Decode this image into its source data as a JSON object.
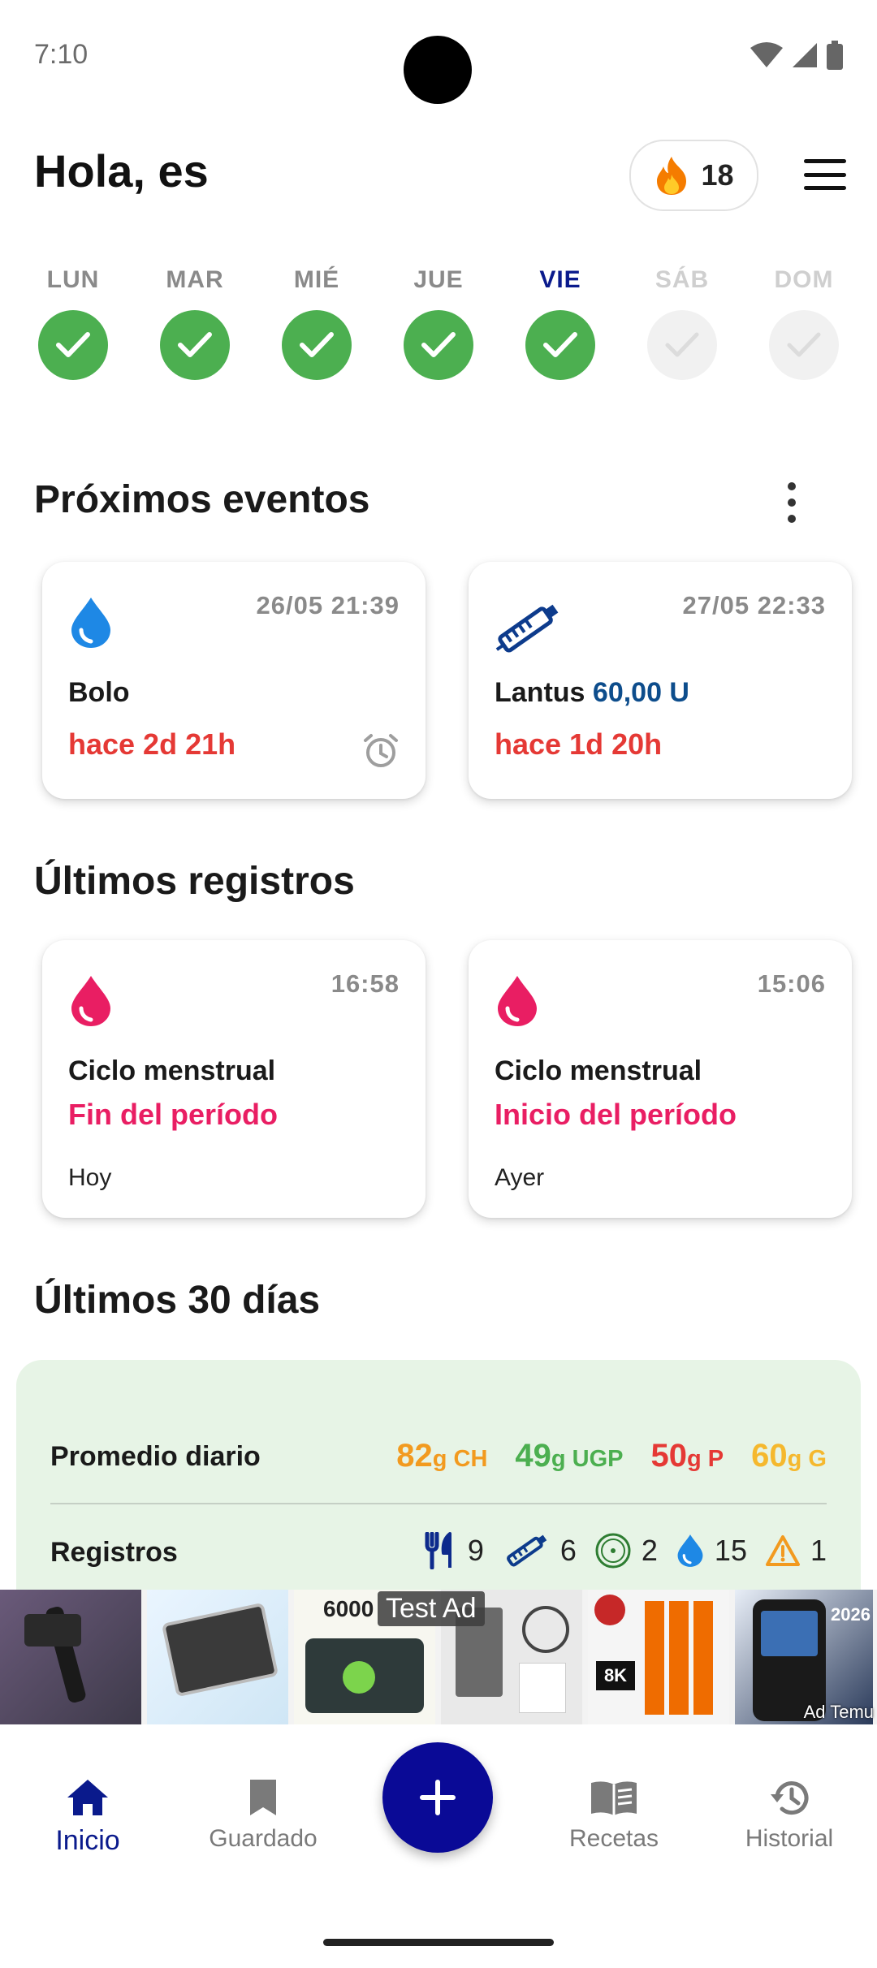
{
  "status": {
    "time": "7:10"
  },
  "header": {
    "greeting": "Hola, es",
    "streak": "18"
  },
  "week": [
    {
      "label": "LUN",
      "done": true
    },
    {
      "label": "MAR",
      "done": true
    },
    {
      "label": "MIÉ",
      "done": true
    },
    {
      "label": "JUE",
      "done": true
    },
    {
      "label": "VIE",
      "done": true,
      "today": true
    },
    {
      "label": "SÁB",
      "done": false
    },
    {
      "label": "DOM",
      "done": false
    }
  ],
  "upcoming": {
    "title": "Próximos eventos",
    "cards": [
      {
        "time": "26/05 21:39",
        "title": "Bolo",
        "extra": "",
        "relative": "hace 2d 21h",
        "icon": "water-drop-icon"
      },
      {
        "time": "27/05 22:33",
        "title": "Lantus",
        "extra": "60,00 U",
        "relative": "hace 1d 20h",
        "icon": "insulin-pen-icon"
      }
    ]
  },
  "latest": {
    "title": "Últimos registros",
    "cards": [
      {
        "time": "16:58",
        "title": "Ciclo menstrual",
        "subtitle": "Fin del período",
        "day": "Hoy",
        "icon": "menstrual-drop-icon"
      },
      {
        "time": "15:06",
        "title": "Ciclo menstrual",
        "subtitle": "Inicio del período",
        "day": "Ayer",
        "icon": "menstrual-drop-icon"
      }
    ]
  },
  "stats": {
    "title": "Últimos 30 días",
    "avg_label": "Promedio diario",
    "avg": [
      {
        "value": "82",
        "unit": "g CH",
        "color": "#f29a1f"
      },
      {
        "value": "49",
        "unit": "g UGP",
        "color": "#4caf50"
      },
      {
        "value": "50",
        "unit": "g P",
        "color": "#e53935"
      },
      {
        "value": "60",
        "unit": "g G",
        "color": "#f5b82e"
      }
    ],
    "reg_label": "Registros",
    "registros": [
      {
        "icon": "fork-knife-icon",
        "count": "9"
      },
      {
        "icon": "insulin-pen-icon",
        "count": "6"
      },
      {
        "icon": "sensor-icon",
        "count": "2"
      },
      {
        "icon": "water-drop-icon",
        "count": "15"
      },
      {
        "icon": "warning-icon",
        "count": "1"
      }
    ]
  },
  "ad": {
    "label": "Test Ad",
    "brand": "Ad Temu"
  },
  "nav": [
    {
      "label": "Inicio",
      "icon": "home-icon",
      "active": true
    },
    {
      "label": "Guardado",
      "icon": "bookmark-icon"
    },
    {
      "label": "Recetas",
      "icon": "book-icon"
    },
    {
      "label": "Historial",
      "icon": "history-icon"
    }
  ],
  "colors": {
    "accent": "#0a1a8c",
    "success": "#4caf50",
    "alert": "#e53935",
    "pink": "#e91e63",
    "drop_blue": "#1e88e5"
  }
}
